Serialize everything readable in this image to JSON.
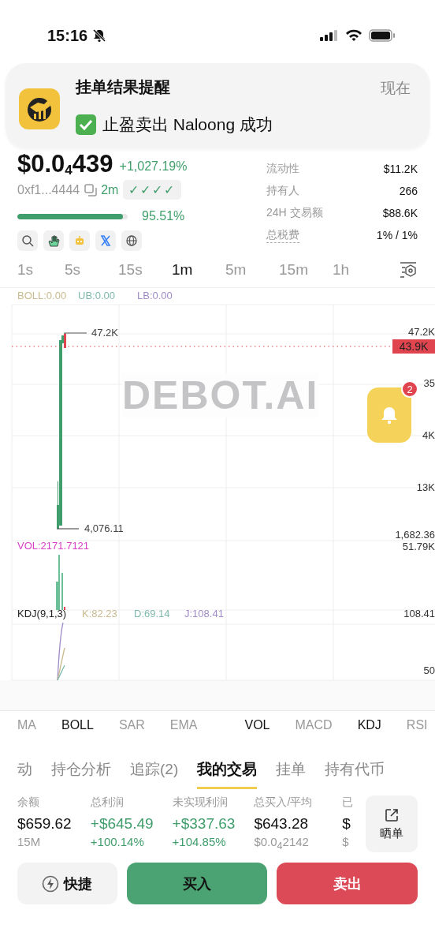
{
  "status_bar": {
    "time": "15:16"
  },
  "notification": {
    "title": "挂单结果提醒",
    "time": "现在",
    "message": "止盈卖出 Naloong 成功"
  },
  "token": {
    "price": "$0.0$_{4}$439",
    "change": "+1,027.19%",
    "address": "0xf1...4444",
    "age": "2m",
    "checks": "✓✓✓✓",
    "progress": {
      "level": 0.9551,
      "reading": "95.51%"
    },
    "links": [
      {
        "kind": "search"
      },
      {
        "kind": "hand"
      },
      {
        "kind": "robot"
      },
      {
        "kind": "x"
      },
      {
        "kind": "globe"
      }
    ]
  },
  "stats": [
    {
      "label": "流动性",
      "value": "$11.2K",
      "dashed": false
    },
    {
      "label": "持有人",
      "value": "266",
      "dashed": false
    },
    {
      "label": "24H 交易额",
      "value": "$88.6K",
      "dashed": false
    },
    {
      "label": "总税费",
      "value": "1% / 1%",
      "dashed": true
    }
  ],
  "timeframes": [
    {
      "label": "1s",
      "selected": false
    },
    {
      "label": "5s",
      "selected": false
    },
    {
      "label": "15s",
      "selected": false
    },
    {
      "label": "1m",
      "selected": true
    },
    {
      "label": "5m",
      "selected": false
    },
    {
      "label": "15m",
      "selected": false
    },
    {
      "label": "1h",
      "selected": false
    }
  ],
  "chart": {
    "watermark": "DEBOT.AI",
    "legend": [
      {
        "text": "BOLL:0.00",
        "color": "#c9bb8f"
      },
      {
        "text": "UB:0.00",
        "color": "#7fb9ad"
      },
      {
        "text": "LB:0.00",
        "color": "#a08bc9"
      }
    ],
    "high": "47.2K",
    "low": "4,076.11",
    "last_price": "43.9K",
    "axis": [
      "47.2K",
      "35",
      "4K",
      "13K",
      "1,682.36"
    ],
    "volume": {
      "legend": "VOL:2171.7121",
      "axis": "51.79K"
    },
    "kdj": {
      "title": "KDJ(9,1,3)",
      "legend": [
        {
          "text": "K:82.23",
          "color": "#c9bb8f"
        },
        {
          "text": "D:69.14",
          "color": "#7fb9ad"
        },
        {
          "text": "J:108.41",
          "color": "#a08bc9"
        }
      ],
      "axis": [
        "108.41",
        "50"
      ]
    }
  },
  "alert_button": {
    "badge": "2"
  },
  "main_indicators": [
    {
      "label": "MA",
      "on": false
    },
    {
      "label": "BOLL",
      "on": true
    },
    {
      "label": "SAR",
      "on": false
    },
    {
      "label": "EMA",
      "on": false
    }
  ],
  "sub_indicators": [
    {
      "label": "VOL",
      "on": true
    },
    {
      "label": "MACD",
      "on": false
    },
    {
      "label": "KDJ",
      "on": true
    },
    {
      "label": "RSI",
      "on": false
    }
  ],
  "trade_tabs": [
    {
      "label": "动",
      "selected": false
    },
    {
      "label": "持仓分析",
      "selected": false
    },
    {
      "label": "追踪(2)",
      "selected": false
    },
    {
      "label": "我的交易",
      "selected": true
    },
    {
      "label": "挂单",
      "selected": false
    },
    {
      "label": "持有代币",
      "selected": false
    }
  ],
  "trade_stats": [
    {
      "label": "余额",
      "value": "$659.62",
      "sub": "15M",
      "positive": false
    },
    {
      "label": "总利润",
      "value": "+$645.49",
      "sub": "+100.14%",
      "positive": true
    },
    {
      "label": "未实现利润",
      "value": "+$337.63",
      "sub": "+104.85%",
      "positive": true
    },
    {
      "label": "总买入/平均",
      "value": "$643.28",
      "sub": "$0.0$_{4}$2142",
      "positive": false
    },
    {
      "label": "已",
      "value": "$",
      "sub": "$",
      "positive": false
    }
  ],
  "share_button": "晒单",
  "actions": [
    {
      "kind": "quick",
      "label": "快捷"
    },
    {
      "kind": "buy",
      "label": "买入"
    },
    {
      "kind": "sell",
      "label": "卖出"
    }
  ]
}
